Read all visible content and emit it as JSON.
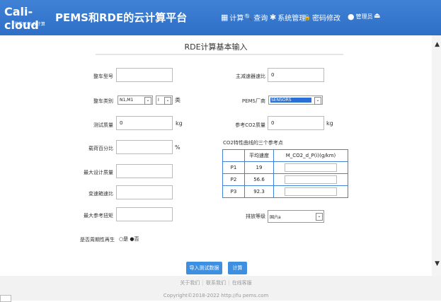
{
  "header": {
    "logo_text": "Cali-cloud",
    "logo_sub": "节能环保·云计算",
    "title": "PEMS和RDE的云计算平台",
    "nav": [
      {
        "icon": "calculator-icon",
        "glyph": "▦",
        "label": "计算"
      },
      {
        "icon": "search-icon",
        "glyph": "🔍",
        "label": "查询"
      },
      {
        "icon": "gear-icon",
        "glyph": "✱",
        "label": "系统管理"
      },
      {
        "icon": "lock-icon",
        "glyph": "🔒",
        "label": "密码修改"
      }
    ],
    "user_label": "管理员",
    "logout_glyph": "⏏"
  },
  "page_title": "RDE计算基本输入",
  "form": {
    "vehicle_model": {
      "label": "整车型号",
      "value": ""
    },
    "vehicle_class": {
      "label": "整车类别",
      "select1": "N1,M1",
      "select2": "I",
      "suffix": "类"
    },
    "test_mass": {
      "label": "测试质量",
      "value": "0",
      "unit": "kg"
    },
    "load_pct": {
      "label": "载荷百分比",
      "value": "",
      "unit": "%"
    },
    "max_design_mass": {
      "label": "最大设计质量",
      "value": ""
    },
    "gearbox_ratio": {
      "label": "变速箱速比",
      "value": ""
    },
    "max_ref_torque": {
      "label": "最大参考扭矩",
      "value": ""
    },
    "main_reducer_ratio": {
      "label": "主减速器速比",
      "value": "0"
    },
    "pems_vendor": {
      "label": "PEMS厂商",
      "value": "SENSORS"
    },
    "ref_co2_mass": {
      "label": "参考CO2质量",
      "value": "0",
      "unit": "kg"
    },
    "emission_level": {
      "label": "排放等级",
      "value": "国六a"
    },
    "periodic_regen": {
      "label": "是否周期性再生",
      "opt_yes": "是",
      "opt_no": "否",
      "selected": "否"
    }
  },
  "co2_table": {
    "title": "CO2特性曲线的三个参考点",
    "headers": [
      "",
      "平均速度",
      "M_CO2_d_P(i)(g/km)"
    ],
    "rows": [
      {
        "name": "P1",
        "speed": "19"
      },
      {
        "name": "P2",
        "speed": "56.6"
      },
      {
        "name": "P3",
        "speed": "92.3"
      }
    ]
  },
  "buttons": {
    "import": "导入测试数据",
    "calculate": "计算"
  },
  "footer": {
    "links": [
      "关于我们",
      "联系我们",
      "在线客服"
    ],
    "copyright": "Copyright©2018-2022 http://fu pems.com"
  },
  "colors": {
    "header": "#2f6fc6",
    "button": "#3f8fe0",
    "table_border": "#3f82d6"
  }
}
